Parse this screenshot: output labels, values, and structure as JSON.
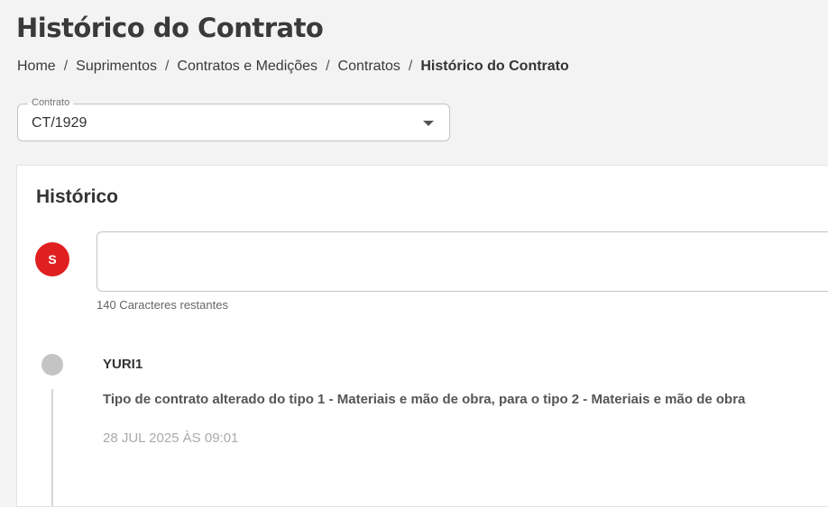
{
  "header": {
    "title": "Histórico do Contrato"
  },
  "breadcrumb": {
    "items": [
      "Home",
      "Suprimentos",
      "Contratos e Medições",
      "Contratos"
    ],
    "current": "Histórico do Contrato",
    "separator": "/"
  },
  "contract_select": {
    "label": "Contrato",
    "value": "CT/1929",
    "icon": "chevron-down-icon"
  },
  "history": {
    "title": "Histórico",
    "avatar_letter": "S",
    "avatar_color": "#e02020",
    "comment_value": "",
    "char_counter": "140 Caracteres restantes",
    "entries": [
      {
        "user": "YURI1",
        "text": "Tipo de contrato alterado do tipo 1 - Materiais e mão de obra, para o tipo 2 - Materiais e mão de obra",
        "date": "28 JUL 2025 ÀS 09:01"
      }
    ]
  }
}
